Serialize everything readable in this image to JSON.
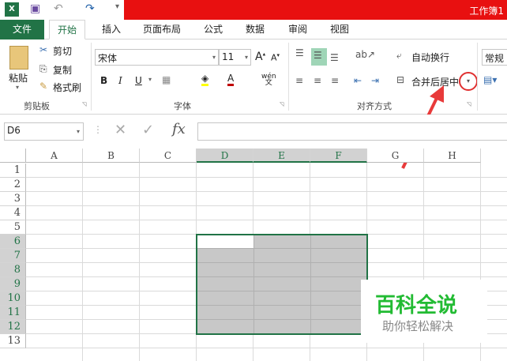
{
  "title": "工作簿1",
  "quick_access": {
    "excel_icon": "excel-logo-icon",
    "save_icon": "save-icon",
    "undo_icon": "undo-icon",
    "redo_icon": "redo-icon"
  },
  "tabs": [
    "文件",
    "开始",
    "插入",
    "页面布局",
    "公式",
    "数据",
    "审阅",
    "视图"
  ],
  "clipboard": {
    "paste": "粘贴",
    "cut": "剪切",
    "copy": "复制",
    "format_painter": "格式刷",
    "group": "剪贴板"
  },
  "font": {
    "name": "宋体",
    "size": "11",
    "bold": "B",
    "italic": "I",
    "underline": "U",
    "wen": "wén",
    "group": "字体"
  },
  "alignment": {
    "wrap": "自动换行",
    "merge": "合并后居中",
    "group": "对齐方式"
  },
  "number": {
    "format": "常规"
  },
  "formula_bar": {
    "name_box": "D6",
    "fx": "fx",
    "value": ""
  },
  "columns": [
    "A",
    "B",
    "C",
    "D",
    "E",
    "F",
    "G",
    "H"
  ],
  "rows": [
    "1",
    "2",
    "3",
    "4",
    "5",
    "6",
    "7",
    "8",
    "9",
    "10",
    "11",
    "12",
    "13"
  ],
  "selection": "D6:F12",
  "watermark": {
    "title": "百科全说",
    "subtitle": "助你轻松解决"
  },
  "colors": {
    "accent": "#217346",
    "title_bar": "#e81010",
    "highlight_circle": "#e03030",
    "watermark": "#22bb33"
  }
}
